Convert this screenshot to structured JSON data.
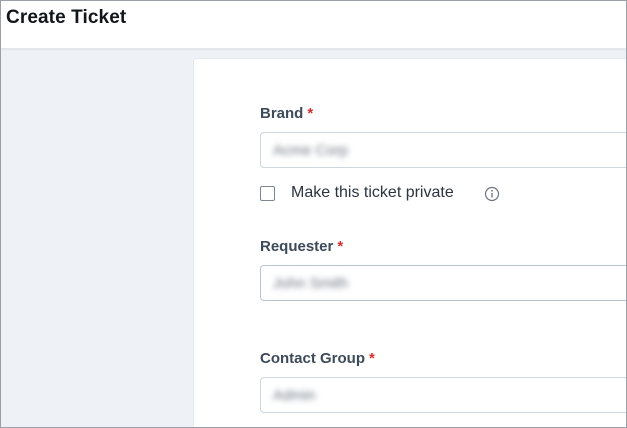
{
  "header": {
    "title": "Create Ticket"
  },
  "form": {
    "brand": {
      "label": "Brand",
      "required_mark": "*",
      "value": "Acme Corp"
    },
    "private": {
      "label": "Make this ticket private",
      "checked": false,
      "icon": "info-icon"
    },
    "requester": {
      "label": "Requester",
      "required_mark": "*",
      "value": "John Smith"
    },
    "contact_group": {
      "label": "Contact Group",
      "required_mark": "*",
      "value": "Admin"
    }
  },
  "colors": {
    "required": "#d72d30",
    "label": "#3c4a5a",
    "background": "#eef2f6"
  }
}
